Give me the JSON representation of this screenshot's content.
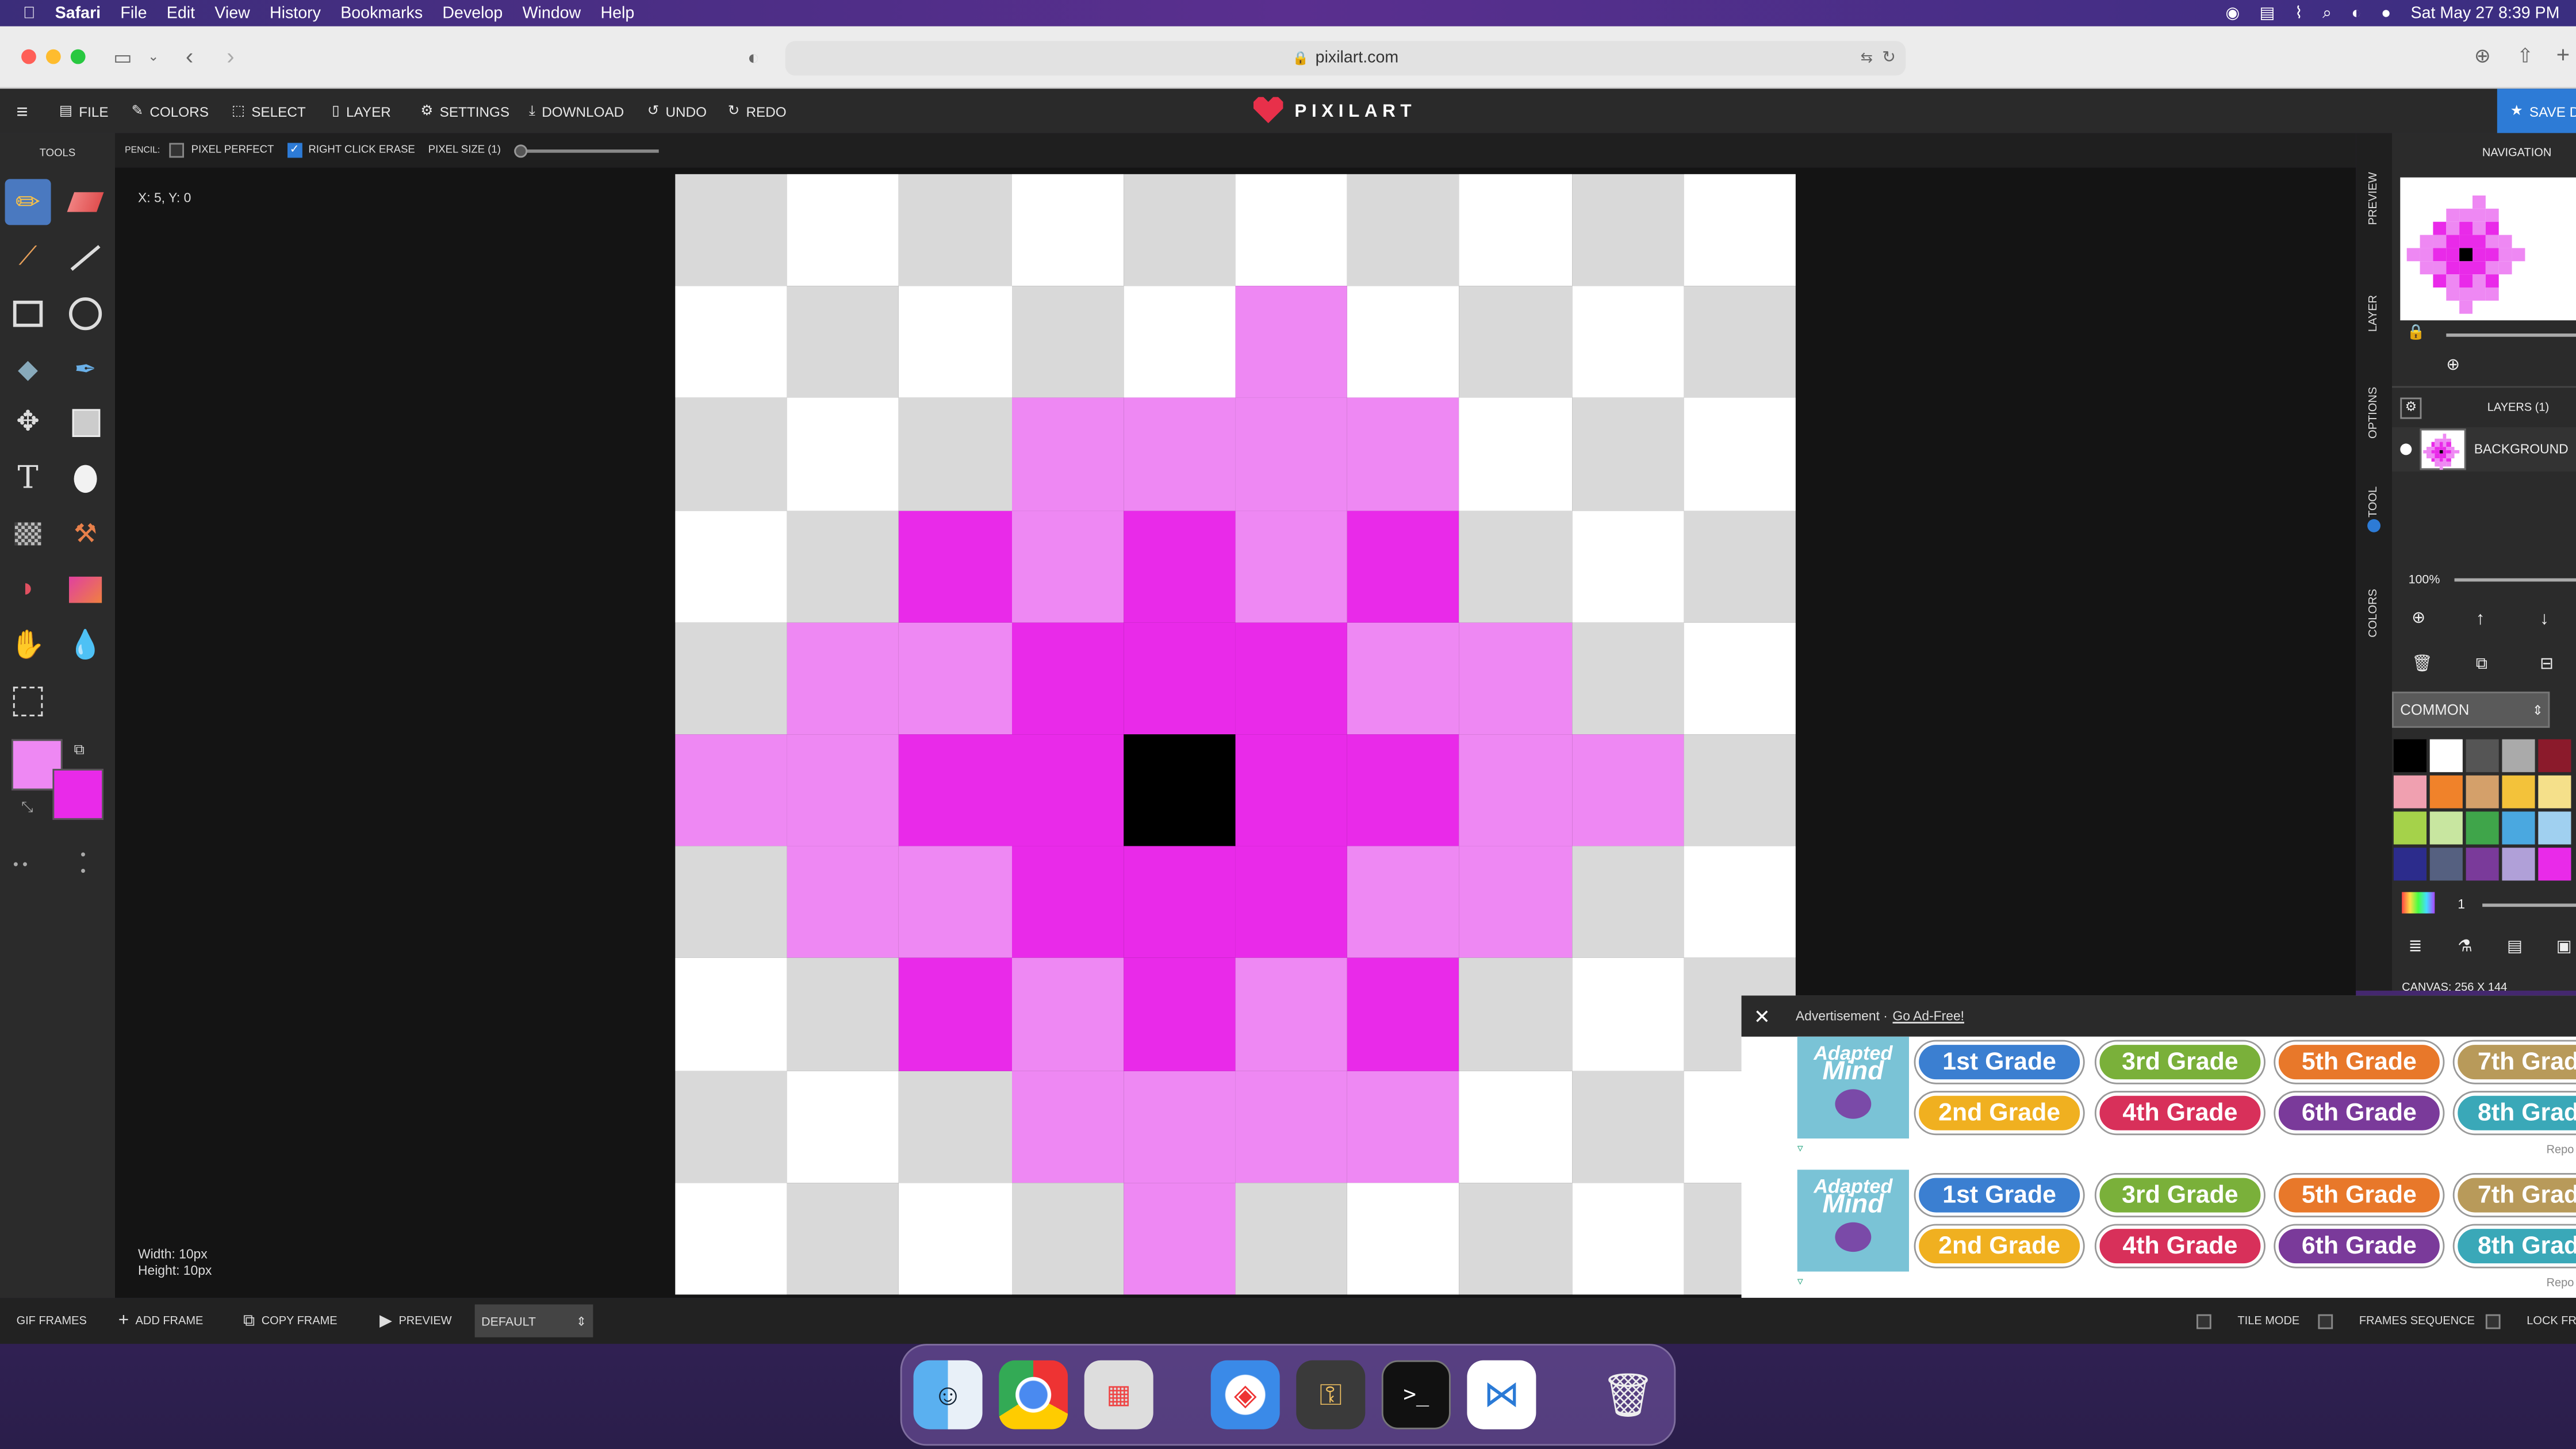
{
  "menubar": {
    "apple": "",
    "app": "Safari",
    "items": [
      "File",
      "Edit",
      "View",
      "History",
      "Bookmarks",
      "Develop",
      "Window",
      "Help"
    ],
    "clock": "Sat May 27  8:39 PM"
  },
  "browser": {
    "url": "pixilart.com"
  },
  "toolbar": {
    "file": "FILE",
    "colors": "COLORS",
    "select": "SELECT",
    "layer": "LAYER",
    "settings": "SETTINGS",
    "download": "DOWNLOAD",
    "undo": "UNDO",
    "redo": "REDO",
    "logo": "PIXILART",
    "save": "SAVE D"
  },
  "options": {
    "tool_label": "PENCIL:",
    "pixel_perfect": "PIXEL PERFECT",
    "right_click_erase": "RIGHT CLICK ERASE",
    "pixel_size": "PIXEL SIZE (1)",
    "pixel_perfect_checked": false,
    "right_click_erase_checked": true
  },
  "tools": {
    "title": "TOOLS"
  },
  "workspace": {
    "coords": "X: 5, Y: 0",
    "width": "Width: 10px",
    "height": "Height: 10px"
  },
  "colors": {
    "primary": "#ee88f3",
    "secondary": "#e92ae9"
  },
  "canvas_pixels": [
    "..........",
    ".....L....",
    "...LLLL...",
    "..MLMLM...",
    ".LLMMMLL..",
    "LLMMKMMLL.",
    ".LLMMMLL..",
    "..MLMLM...",
    "...LLLL...",
    "....L....."
  ],
  "palette_map": {
    "L": "#ee88f3",
    "M": "#e92ae9",
    "K": "#000000"
  },
  "side_tabs": [
    "PREVIEW",
    "LAYER",
    "OPTIONS",
    "TOOL",
    "COLORS"
  ],
  "rightpanel": {
    "navigation": "NAVIGATION",
    "layers": "LAYERS (1)",
    "background": "BACKGROUND",
    "zoom": "100%",
    "palette_select": "COMMON",
    "brush_size": "1",
    "canvas_info": "CANVAS: 256 X 144"
  },
  "palette": [
    "#000000",
    "#ffffff",
    "#555555",
    "#aaaaaa",
    "#8b1a2b",
    "#f0a0b0",
    "#f0822a",
    "#d4a06a",
    "#f3c23a",
    "#f5e08a",
    "#a5d24a",
    "#c8e6a0",
    "#3fa54a",
    "#4aa8e0",
    "#a0d0f0",
    "#2c2c8c",
    "#556080",
    "#7a3a9a",
    "#b0a0d8",
    "#e92ae9"
  ],
  "bottom": {
    "gif_frames": "GIF FRAMES",
    "add_frame": "ADD FRAME",
    "copy_frame": "COPY FRAME",
    "preview": "PREVIEW",
    "default": "DEFAULT",
    "tile_mode": "TILE MODE",
    "frames_sequence": "FRAMES SEQUENCE",
    "lock_frames": "LOCK FRA"
  },
  "ad": {
    "label": "Advertisement · ",
    "go_ad_free": "Go Ad-Free!",
    "brand_top": "Adapted",
    "brand_bottom": "Mind",
    "grades_row1": [
      "1st Grade",
      "3rd Grade",
      "5th Grade",
      "7th Grad"
    ],
    "grades_row2": [
      "2nd Grade",
      "4th Grade",
      "6th Grade",
      "8th Grad"
    ],
    "report": "Repo"
  }
}
